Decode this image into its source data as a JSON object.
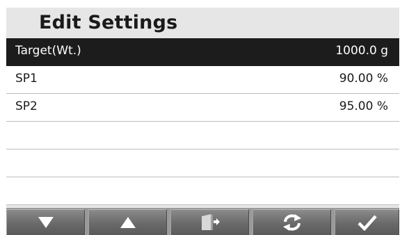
{
  "header": {
    "title": "Edit Settings"
  },
  "settings": [
    {
      "label": "Target(Wt.)",
      "value": "1000.0 g",
      "selected": true
    },
    {
      "label": "SP1",
      "value": "90.00 %",
      "selected": false
    },
    {
      "label": "SP2",
      "value": "95.00 %",
      "selected": false
    },
    {
      "label": "",
      "value": "",
      "selected": false
    },
    {
      "label": "",
      "value": "",
      "selected": false
    },
    {
      "label": "",
      "value": "",
      "selected": false
    }
  ],
  "toolbar": {
    "buttons": [
      {
        "icon": "arrow-down-icon"
      },
      {
        "icon": "arrow-up-icon"
      },
      {
        "icon": "exit-door-icon"
      },
      {
        "icon": "refresh-icon"
      },
      {
        "icon": "checkmark-icon"
      }
    ]
  },
  "colors": {
    "selected_row_bg": "#1c1c1c",
    "row_bg": "#ffffff",
    "header_bg": "#e6e6e6",
    "toolbar_button": "#6a6a6a"
  }
}
